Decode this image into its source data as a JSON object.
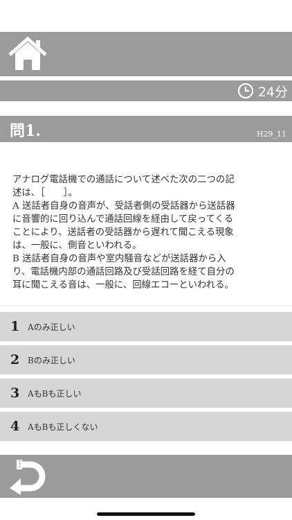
{
  "timer": {
    "text": "24分"
  },
  "question": {
    "title": "問1.",
    "code": "H29_11",
    "body": "アナログ電話機での通話について述べた次の二つの記\n述は、［　　］。\nA 送話者自身の音声が、受話者側の受話器から送話器\nに音響的に回り込んで通話回線を経由して戻ってくる\nことにより、送話者の受話器から遅れて聞こえる現象\nは、一般に、側音といわれる。\nB 送話者自身の音声や室内騒音などが送話器から入\nり、電話機内部の通話回路及び受話回路を経て自分の\n耳に聞こえる音は、一般に、回線エコーといわれる。"
  },
  "choices": [
    {
      "num": "1",
      "label": "Aのみ正しい"
    },
    {
      "num": "2",
      "label": "Bのみ正しい"
    },
    {
      "num": "3",
      "label": "AもBも正しい"
    },
    {
      "num": "4",
      "label": "AもBも正しくない"
    }
  ],
  "icons": {
    "home": "home-icon",
    "clock": "clock-icon",
    "back": "back-arrow-icon"
  },
  "colors": {
    "bar": "#9b9b9b",
    "choice": "#d6d6d6"
  }
}
